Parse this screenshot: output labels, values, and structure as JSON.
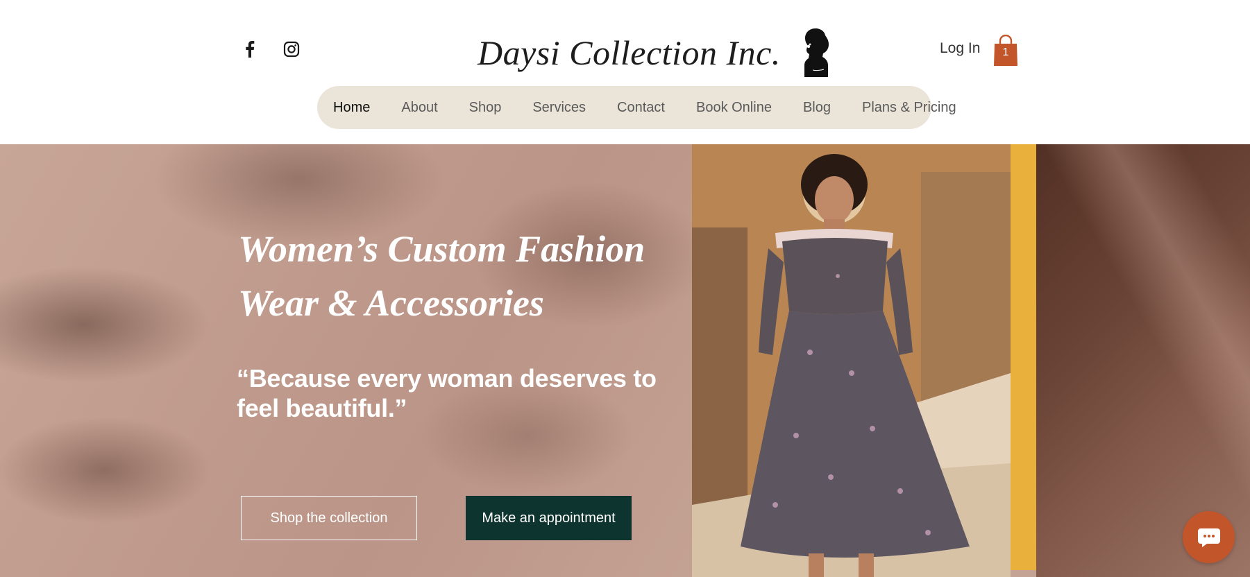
{
  "header": {
    "brand_name": "Daysi Collection Inc.",
    "social": [
      {
        "icon": "facebook-icon"
      },
      {
        "icon": "instagram-icon"
      }
    ],
    "login_label": "Log In",
    "cart_count": "1"
  },
  "nav": {
    "items": [
      {
        "label": "Home",
        "active": true
      },
      {
        "label": "About"
      },
      {
        "label": "Shop"
      },
      {
        "label": "Services"
      },
      {
        "label": "Contact"
      },
      {
        "label": "Book Online"
      },
      {
        "label": "Blog"
      },
      {
        "label": "Plans & Pricing"
      }
    ]
  },
  "hero": {
    "title": "Women’s Custom Fashion Wear & Accessories",
    "quote": "“Because every woman deserves to feel beautiful.”",
    "primary_button": "Shop the collection",
    "secondary_button": "Make an appointment"
  },
  "colors": {
    "nav_background": "#ebe4d8",
    "accent_orange": "#c3552a",
    "button_dark": "#0e3430",
    "gold_bar": "#e9b13b"
  },
  "chat": {
    "icon": "chat-bubble-icon"
  }
}
